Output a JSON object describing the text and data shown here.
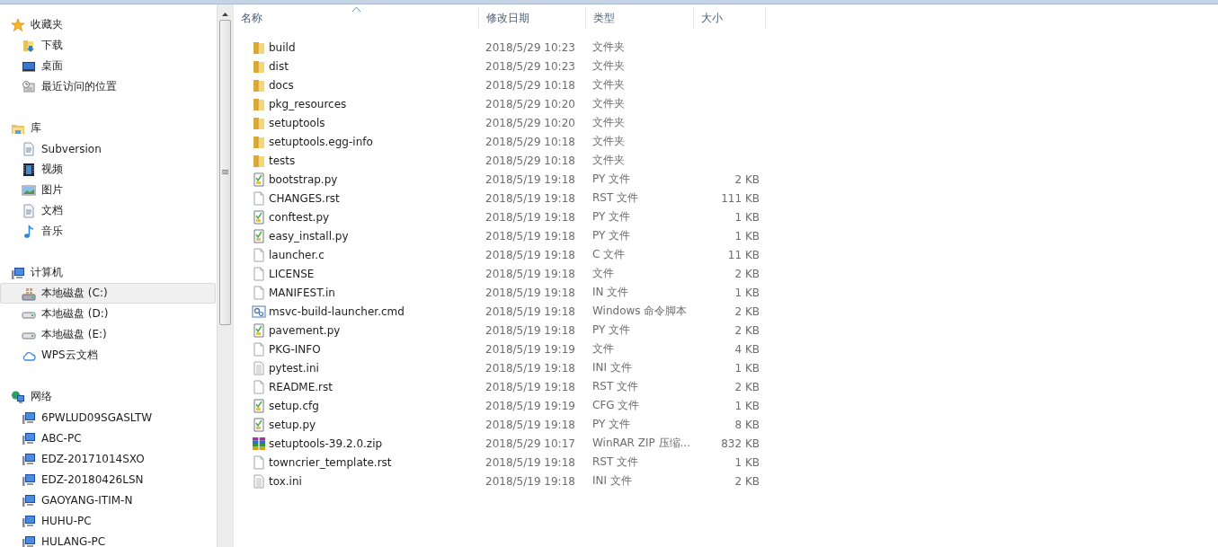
{
  "sidebar": {
    "groups": [
      {
        "label": "收藏夹",
        "kind": "star",
        "items": [
          {
            "label": "下载",
            "kind": "download",
            "selected": false
          },
          {
            "label": "桌面",
            "kind": "desktop",
            "selected": false
          },
          {
            "label": "最近访问的位置",
            "kind": "recent",
            "selected": false
          }
        ]
      },
      {
        "label": "库",
        "kind": "library",
        "items": [
          {
            "label": "Subversion",
            "kind": "doc",
            "selected": false
          },
          {
            "label": "视频",
            "kind": "video",
            "selected": false
          },
          {
            "label": "图片",
            "kind": "picture",
            "selected": false
          },
          {
            "label": "文档",
            "kind": "doc",
            "selected": false
          },
          {
            "label": "音乐",
            "kind": "music",
            "selected": false
          }
        ]
      },
      {
        "label": "计算机",
        "kind": "computer",
        "items": [
          {
            "label": "本地磁盘 (C:)",
            "kind": "sysdrive",
            "selected": true
          },
          {
            "label": "本地磁盘 (D:)",
            "kind": "drive",
            "selected": false
          },
          {
            "label": "本地磁盘 (E:)",
            "kind": "drive",
            "selected": false
          },
          {
            "label": "WPS云文档",
            "kind": "cloud",
            "selected": false
          }
        ]
      },
      {
        "label": "网络",
        "kind": "network",
        "items": [
          {
            "label": "6PWLUD09SGASLTW",
            "kind": "pc",
            "selected": false
          },
          {
            "label": "ABC-PC",
            "kind": "pc",
            "selected": false
          },
          {
            "label": "EDZ-20171014SXO",
            "kind": "pc",
            "selected": false
          },
          {
            "label": "EDZ-20180426LSN",
            "kind": "pc",
            "selected": false
          },
          {
            "label": "GAOYANG-ITIM-N",
            "kind": "pc",
            "selected": false
          },
          {
            "label": "HUHU-PC",
            "kind": "pc",
            "selected": false
          },
          {
            "label": "HULANG-PC",
            "kind": "pc",
            "selected": false
          }
        ]
      }
    ]
  },
  "table": {
    "columns": [
      {
        "label": "名称",
        "sorted": true
      },
      {
        "label": "修改日期",
        "sorted": false
      },
      {
        "label": "类型",
        "sorted": false
      },
      {
        "label": "大小",
        "sorted": false
      }
    ],
    "rows": [
      {
        "kind": "folder",
        "name": "build",
        "date": "2018/5/29 10:23",
        "type": "文件夹"
      },
      {
        "kind": "folder",
        "name": "dist",
        "date": "2018/5/29 10:23",
        "type": "文件夹"
      },
      {
        "kind": "folder",
        "name": "docs",
        "date": "2018/5/29 10:18",
        "type": "文件夹"
      },
      {
        "kind": "folder",
        "name": "pkg_resources",
        "date": "2018/5/29 10:20",
        "type": "文件夹"
      },
      {
        "kind": "folder",
        "name": "setuptools",
        "date": "2018/5/29 10:20",
        "type": "文件夹"
      },
      {
        "kind": "folder",
        "name": "setuptools.egg-info",
        "date": "2018/5/29 10:18",
        "type": "文件夹"
      },
      {
        "kind": "folder",
        "name": "tests",
        "date": "2018/5/29 10:18",
        "type": "文件夹"
      },
      {
        "kind": "script",
        "name": "bootstrap.py",
        "date": "2018/5/19 19:18",
        "type": "PY 文件",
        "size": "2 KB"
      },
      {
        "kind": "blank",
        "name": "CHANGES.rst",
        "date": "2018/5/19 19:18",
        "type": "RST 文件",
        "size": "111 KB"
      },
      {
        "kind": "script",
        "name": "conftest.py",
        "date": "2018/5/19 19:18",
        "type": "PY 文件",
        "size": "1 KB"
      },
      {
        "kind": "script",
        "name": "easy_install.py",
        "date": "2018/5/19 19:18",
        "type": "PY 文件",
        "size": "1 KB"
      },
      {
        "kind": "blank",
        "name": "launcher.c",
        "date": "2018/5/19 19:18",
        "type": "C 文件",
        "size": "11 KB"
      },
      {
        "kind": "blank",
        "name": "LICENSE",
        "date": "2018/5/19 19:18",
        "type": "文件",
        "size": "2 KB"
      },
      {
        "kind": "blank",
        "name": "MANIFEST.in",
        "date": "2018/5/19 19:18",
        "type": "IN 文件",
        "size": "1 KB"
      },
      {
        "kind": "cmd",
        "name": "msvc-build-launcher.cmd",
        "date": "2018/5/19 19:18",
        "type": "Windows 命令脚本",
        "size": "2 KB"
      },
      {
        "kind": "script",
        "name": "pavement.py",
        "date": "2018/5/19 19:18",
        "type": "PY 文件",
        "size": "2 KB"
      },
      {
        "kind": "blank",
        "name": "PKG-INFO",
        "date": "2018/5/19 19:19",
        "type": "文件",
        "size": "4 KB"
      },
      {
        "kind": "text",
        "name": "pytest.ini",
        "date": "2018/5/19 19:18",
        "type": "INI 文件",
        "size": "1 KB"
      },
      {
        "kind": "blank",
        "name": "README.rst",
        "date": "2018/5/19 19:18",
        "type": "RST 文件",
        "size": "2 KB"
      },
      {
        "kind": "script",
        "name": "setup.cfg",
        "date": "2018/5/19 19:19",
        "type": "CFG 文件",
        "size": "1 KB"
      },
      {
        "kind": "script",
        "name": "setup.py",
        "date": "2018/5/19 19:18",
        "type": "PY 文件",
        "size": "8 KB"
      },
      {
        "kind": "archive",
        "name": "setuptools-39.2.0.zip",
        "date": "2018/5/29 10:17",
        "type": "WinRAR ZIP 压缩...",
        "size": "832 KB"
      },
      {
        "kind": "blank",
        "name": "towncrier_template.rst",
        "date": "2018/5/19 19:18",
        "type": "RST 文件",
        "size": "1 KB"
      },
      {
        "kind": "text",
        "name": "tox.ini",
        "date": "2018/5/19 19:18",
        "type": "INI 文件",
        "size": "2 KB"
      }
    ]
  }
}
